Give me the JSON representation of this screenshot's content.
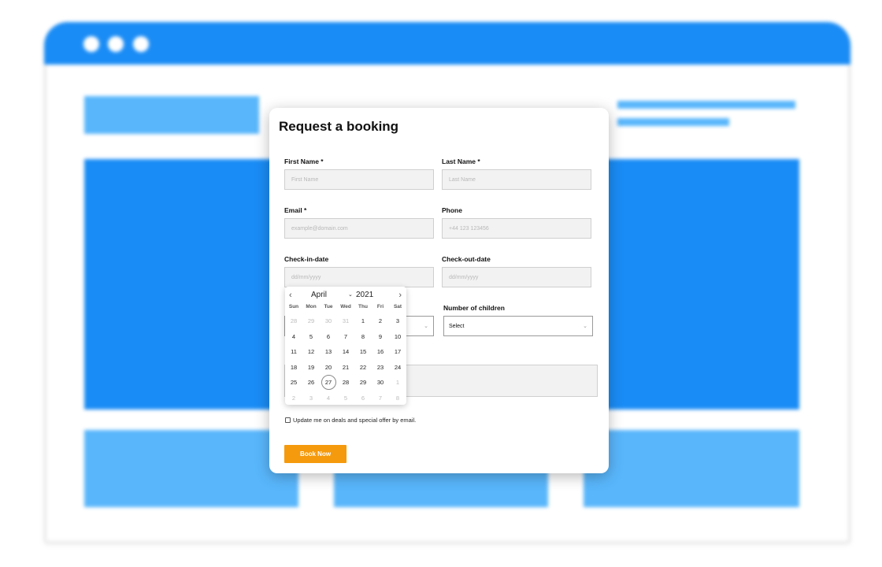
{
  "form": {
    "title": "Request a booking",
    "first_name": {
      "label": "First Name *",
      "placeholder": "First Name"
    },
    "last_name": {
      "label": "Last Name *",
      "placeholder": "Last Name"
    },
    "email": {
      "label": "Email *",
      "placeholder": "example@domain.com"
    },
    "phone": {
      "label": "Phone",
      "placeholder": "+44 123 123456"
    },
    "check_in": {
      "label": "Check-in-date",
      "placeholder": "dd/mm/yyyy"
    },
    "check_out": {
      "label": "Check-out-date",
      "placeholder": "dd/mm/yyyy"
    },
    "children": {
      "label": "Number of children",
      "value": "Select"
    },
    "newsletter": {
      "label": "Update me on deals and special offer by email.",
      "checked": false
    },
    "submit_label": "Book Now"
  },
  "datepicker": {
    "prev_icon": "chevron-left-icon",
    "next_icon": "chevron-right-icon",
    "month": "April",
    "year": "2021",
    "weekdays": [
      "Sun",
      "Mon",
      "Tue",
      "Wed",
      "Thu",
      "Fri",
      "Sat"
    ],
    "today": "27",
    "weeks": [
      [
        [
          "28",
          true
        ],
        [
          "29",
          true
        ],
        [
          "30",
          true
        ],
        [
          "31",
          true
        ],
        [
          "1",
          false
        ],
        [
          "2",
          false
        ],
        [
          "3",
          false
        ]
      ],
      [
        [
          "4",
          false
        ],
        [
          "5",
          false
        ],
        [
          "6",
          false
        ],
        [
          "7",
          false
        ],
        [
          "8",
          false
        ],
        [
          "9",
          false
        ],
        [
          "10",
          false
        ]
      ],
      [
        [
          "11",
          false
        ],
        [
          "12",
          false
        ],
        [
          "13",
          false
        ],
        [
          "14",
          false
        ],
        [
          "15",
          false
        ],
        [
          "16",
          false
        ],
        [
          "17",
          false
        ]
      ],
      [
        [
          "18",
          false
        ],
        [
          "19",
          false
        ],
        [
          "20",
          false
        ],
        [
          "21",
          false
        ],
        [
          "22",
          false
        ],
        [
          "23",
          false
        ],
        [
          "24",
          false
        ]
      ],
      [
        [
          "25",
          false
        ],
        [
          "26",
          false
        ],
        [
          "27",
          false
        ],
        [
          "28",
          false
        ],
        [
          "29",
          false
        ],
        [
          "30",
          false
        ],
        [
          "1",
          true
        ]
      ],
      [
        [
          "2",
          true
        ],
        [
          "3",
          true
        ],
        [
          "4",
          true
        ],
        [
          "5",
          true
        ],
        [
          "6",
          true
        ],
        [
          "7",
          true
        ],
        [
          "8",
          true
        ]
      ]
    ]
  },
  "colors": {
    "browser_blue": "#1a8cf5",
    "browser_light_blue": "#59b6fb",
    "button_orange": "#f59a0c"
  }
}
